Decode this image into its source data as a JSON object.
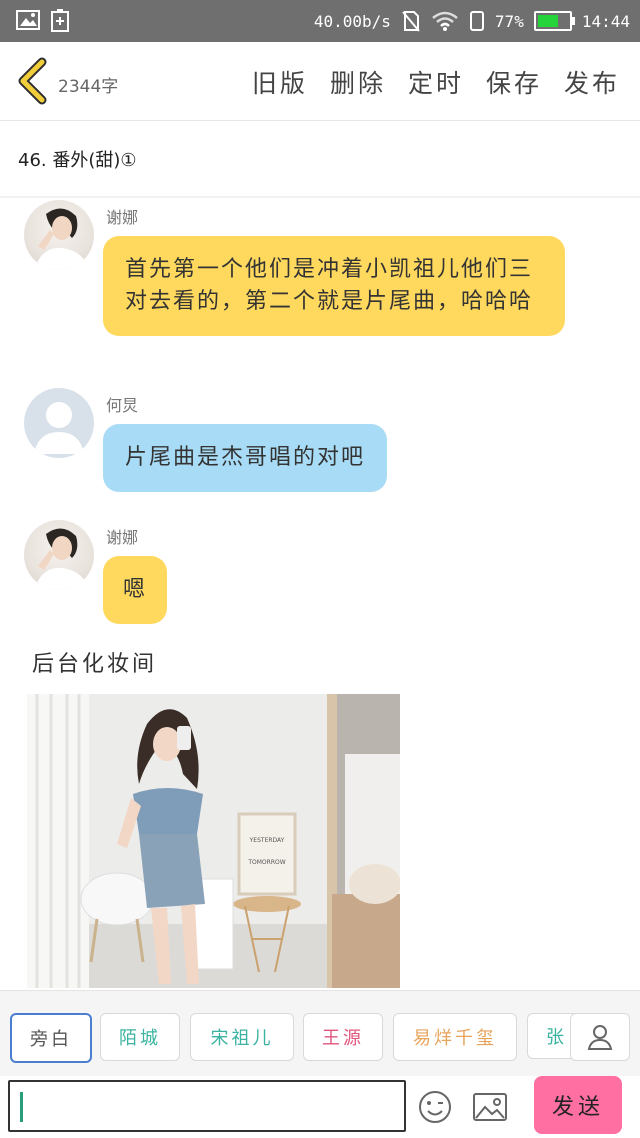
{
  "status_bar": {
    "network_speed": "40.00b/s",
    "battery_percent": "77%",
    "battery_level": 0.77,
    "time": "14:44"
  },
  "header": {
    "back_icon": "chevron-left-icon",
    "word_count": "2344字",
    "actions": [
      "旧版",
      "删除",
      "定时",
      "保存",
      "发布"
    ]
  },
  "chapter": {
    "title": "46. 番外(甜)①"
  },
  "messages": [
    {
      "speaker": "谢娜",
      "avatar": "photo",
      "bubble_color": "#ffd95e",
      "text": "首先第一个他们是冲着小凯祖儿他们三对去看的，第二个就是片尾曲，哈哈哈"
    },
    {
      "speaker": "何炅",
      "avatar": "placeholder",
      "bubble_color": "#a8dcf6",
      "text": "片尾曲是杰哥唱的对吧"
    },
    {
      "speaker": "谢娜",
      "avatar": "photo",
      "bubble_color": "#ffd95e",
      "text": "嗯"
    }
  ],
  "scene": {
    "label": "后台化妆间",
    "photo_sign_text": "YESTERDAY · TOMORROW"
  },
  "roles": [
    {
      "label": "旁白",
      "color": "#555555",
      "active": true
    },
    {
      "label": "陌城",
      "color": "#3bb3a0",
      "active": false
    },
    {
      "label": "宋祖儿",
      "color": "#3bb3a0",
      "active": false
    },
    {
      "label": "王源",
      "color": "#e0557e",
      "active": false
    },
    {
      "label": "易烊千玺",
      "color": "#e8a35a",
      "active": false
    },
    {
      "label": "张",
      "color": "#3bb3a0",
      "active": false
    }
  ],
  "input": {
    "placeholder": "",
    "send_label": "发送",
    "emoji_icon": "smiley-icon",
    "image_icon": "image-icon",
    "user_icon": "user-icon"
  }
}
